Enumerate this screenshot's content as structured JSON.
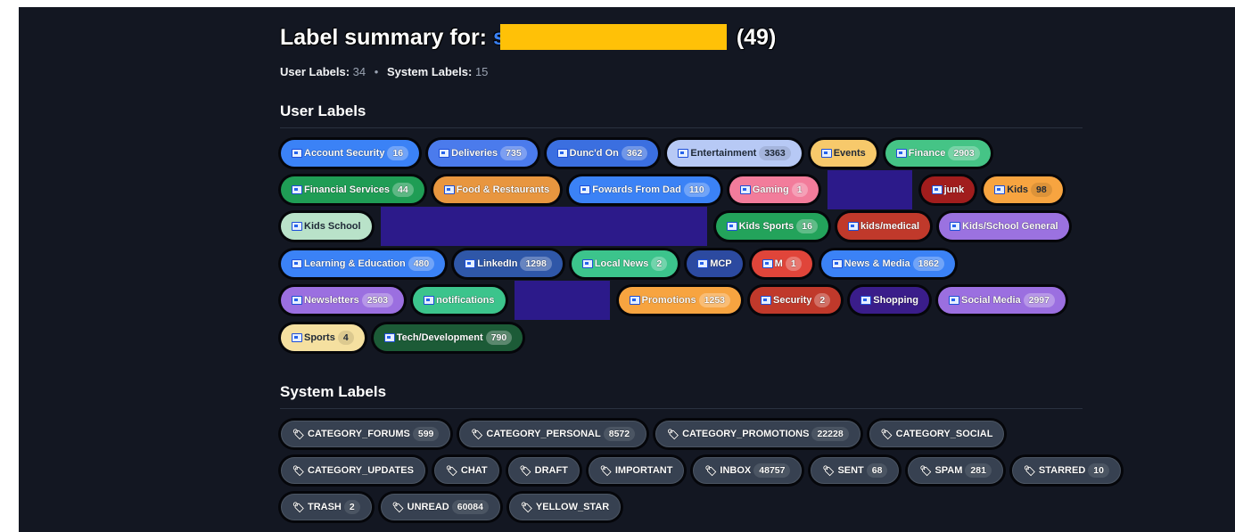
{
  "header": {
    "title_prefix": "Label summary for:",
    "title_link": "s",
    "title_count": "(49)",
    "user_labels_label": "User Labels:",
    "user_labels_count": "34",
    "separator": "•",
    "system_labels_label": "System Labels:",
    "system_labels_count": "15"
  },
  "sections": {
    "user_heading": "User Labels",
    "system_heading": "System Labels"
  },
  "colors": {
    "background": "#131722",
    "redaction_yellow": "#ffc107",
    "redaction_purple": "#2c1a8a"
  },
  "user_labels": [
    {
      "name": "Account Security",
      "count": "16",
      "color": "#3b82f6"
    },
    {
      "name": "Deliveries",
      "count": "735",
      "color": "#4b7bec"
    },
    {
      "name": "Dunc'd On",
      "count": "362",
      "color": "#3b6fe0"
    },
    {
      "name": "Entertainment",
      "count": "3363",
      "color": "#b7c9f5"
    },
    {
      "name": "Events",
      "count": "",
      "color": "#f7c96b"
    },
    {
      "name": "Finance",
      "count": "2903",
      "color": "#45c486"
    },
    {
      "name": "Financial Services",
      "count": "44",
      "color": "#1f9d55"
    },
    {
      "name": "Food & Restaurants",
      "count": "",
      "color": "#e8963f"
    },
    {
      "name": "Fowards From Dad",
      "count": "110",
      "color": "#3b82f6"
    },
    {
      "name": "Gaming",
      "count": "1",
      "color": "#f27c9b"
    },
    {
      "name": "junk",
      "count": "",
      "color": "#a11d1d"
    },
    {
      "name": "Kids",
      "count": "98",
      "color": "#f7a440"
    },
    {
      "name": "Kids School",
      "count": "",
      "color": "#b9e2c9"
    },
    {
      "name": "Kids Sports",
      "count": "16",
      "color": "#23a35b"
    },
    {
      "name": "kids/medical",
      "count": "",
      "color": "#c0392b"
    },
    {
      "name": "Kids/School General",
      "count": "",
      "color": "#9b72e0"
    },
    {
      "name": "Learning & Education",
      "count": "480",
      "color": "#3b82f6"
    },
    {
      "name": "LinkedIn",
      "count": "1298",
      "color": "#2f57a8"
    },
    {
      "name": "Local News",
      "count": "2",
      "color": "#3cc48c"
    },
    {
      "name": "MCP",
      "count": "",
      "color": "#2c4aa0"
    },
    {
      "name": "M",
      "count": "1",
      "color": "#e0453a"
    },
    {
      "name": "News & Media",
      "count": "1862",
      "color": "#3b82f6"
    },
    {
      "name": "Newsletters",
      "count": "2503",
      "color": "#9b6fe0"
    },
    {
      "name": "notifications",
      "count": "",
      "color": "#3cc48c"
    },
    {
      "name": "Promotions",
      "count": "1253",
      "color": "#f7a440"
    },
    {
      "name": "Security",
      "count": "2",
      "color": "#c0392b"
    },
    {
      "name": "Shopping",
      "count": "",
      "color": "#3a1d8a"
    },
    {
      "name": "Social Media",
      "count": "2997",
      "color": "#9b6fe0"
    },
    {
      "name": "Sports",
      "count": "4",
      "color": "#f5e0a0"
    },
    {
      "name": "Tech/Development",
      "count": "790",
      "color": "#1c5b37"
    }
  ],
  "system_labels": [
    {
      "name": "CATEGORY_FORUMS",
      "count": "599"
    },
    {
      "name": "CATEGORY_PERSONAL",
      "count": "8572"
    },
    {
      "name": "CATEGORY_PROMOTIONS",
      "count": "22228"
    },
    {
      "name": "CATEGORY_SOCIAL",
      "count": ""
    },
    {
      "name": "CATEGORY_UPDATES",
      "count": ""
    },
    {
      "name": "CHAT",
      "count": ""
    },
    {
      "name": "DRAFT",
      "count": ""
    },
    {
      "name": "IMPORTANT",
      "count": ""
    },
    {
      "name": "INBOX",
      "count": "48757"
    },
    {
      "name": "SENT",
      "count": "68"
    },
    {
      "name": "SPAM",
      "count": "281"
    },
    {
      "name": "STARRED",
      "count": "10"
    },
    {
      "name": "TRASH",
      "count": "2"
    },
    {
      "name": "UNREAD",
      "count": "60084"
    },
    {
      "name": "YELLOW_STAR",
      "count": ""
    }
  ]
}
